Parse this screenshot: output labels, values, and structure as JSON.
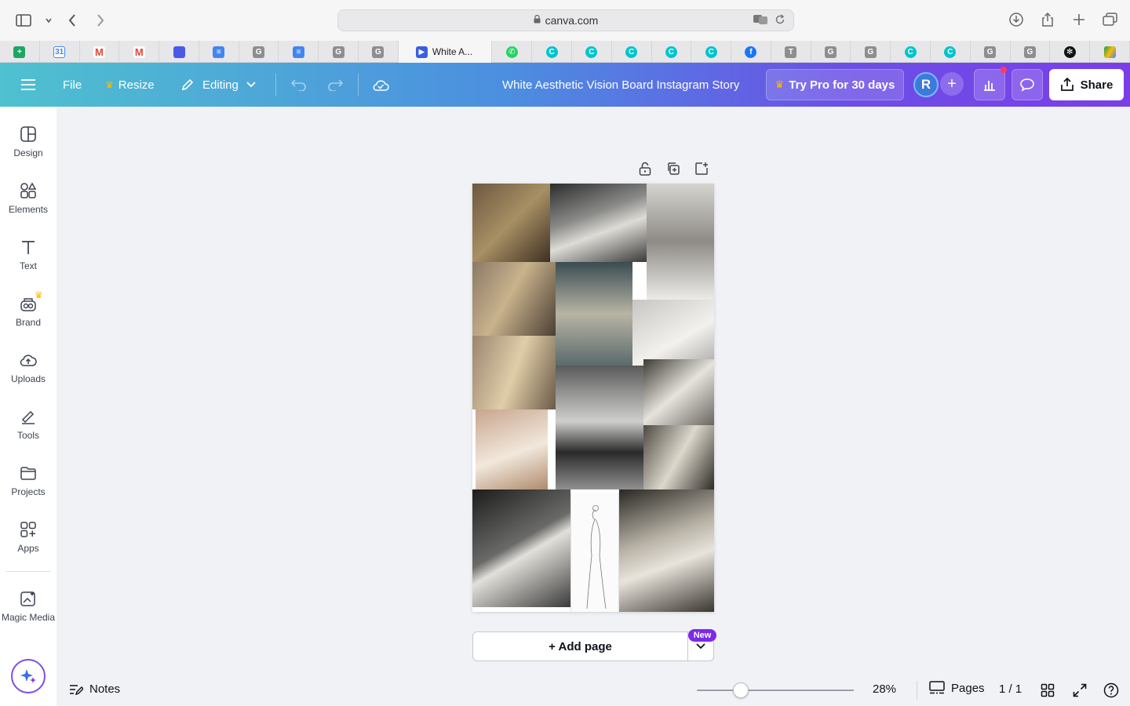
{
  "browser": {
    "url": "canva.com",
    "active_tab_label": "White A..."
  },
  "header": {
    "file_label": "File",
    "resize_label": "Resize",
    "editing_label": "Editing",
    "doc_title": "White Aesthetic Vision Board Instagram Story",
    "try_pro_label": "Try Pro for 30 days",
    "avatar_initial": "R",
    "share_label": "Share"
  },
  "sidebar": {
    "items": [
      {
        "label": "Design",
        "icon": "design-icon"
      },
      {
        "label": "Elements",
        "icon": "elements-icon"
      },
      {
        "label": "Text",
        "icon": "text-icon"
      },
      {
        "label": "Brand",
        "icon": "brand-icon"
      },
      {
        "label": "Uploads",
        "icon": "uploads-icon"
      },
      {
        "label": "Tools",
        "icon": "tools-icon"
      },
      {
        "label": "Projects",
        "icon": "projects-icon"
      },
      {
        "label": "Apps",
        "icon": "apps-icon"
      },
      {
        "label": "Magic Media",
        "icon": "magic-media-icon"
      }
    ]
  },
  "canvas": {
    "add_page_label": "+ Add page",
    "new_badge": "New"
  },
  "bottom_bar": {
    "notes_label": "Notes",
    "zoom_value": "28%",
    "zoom_level": 0.28,
    "pages_label": "Pages",
    "page_count": "1 / 1"
  },
  "colors": {
    "header_start": "#4fc1cf",
    "header_end": "#7a3ee9",
    "accent_purple": "#7d2ae8"
  }
}
